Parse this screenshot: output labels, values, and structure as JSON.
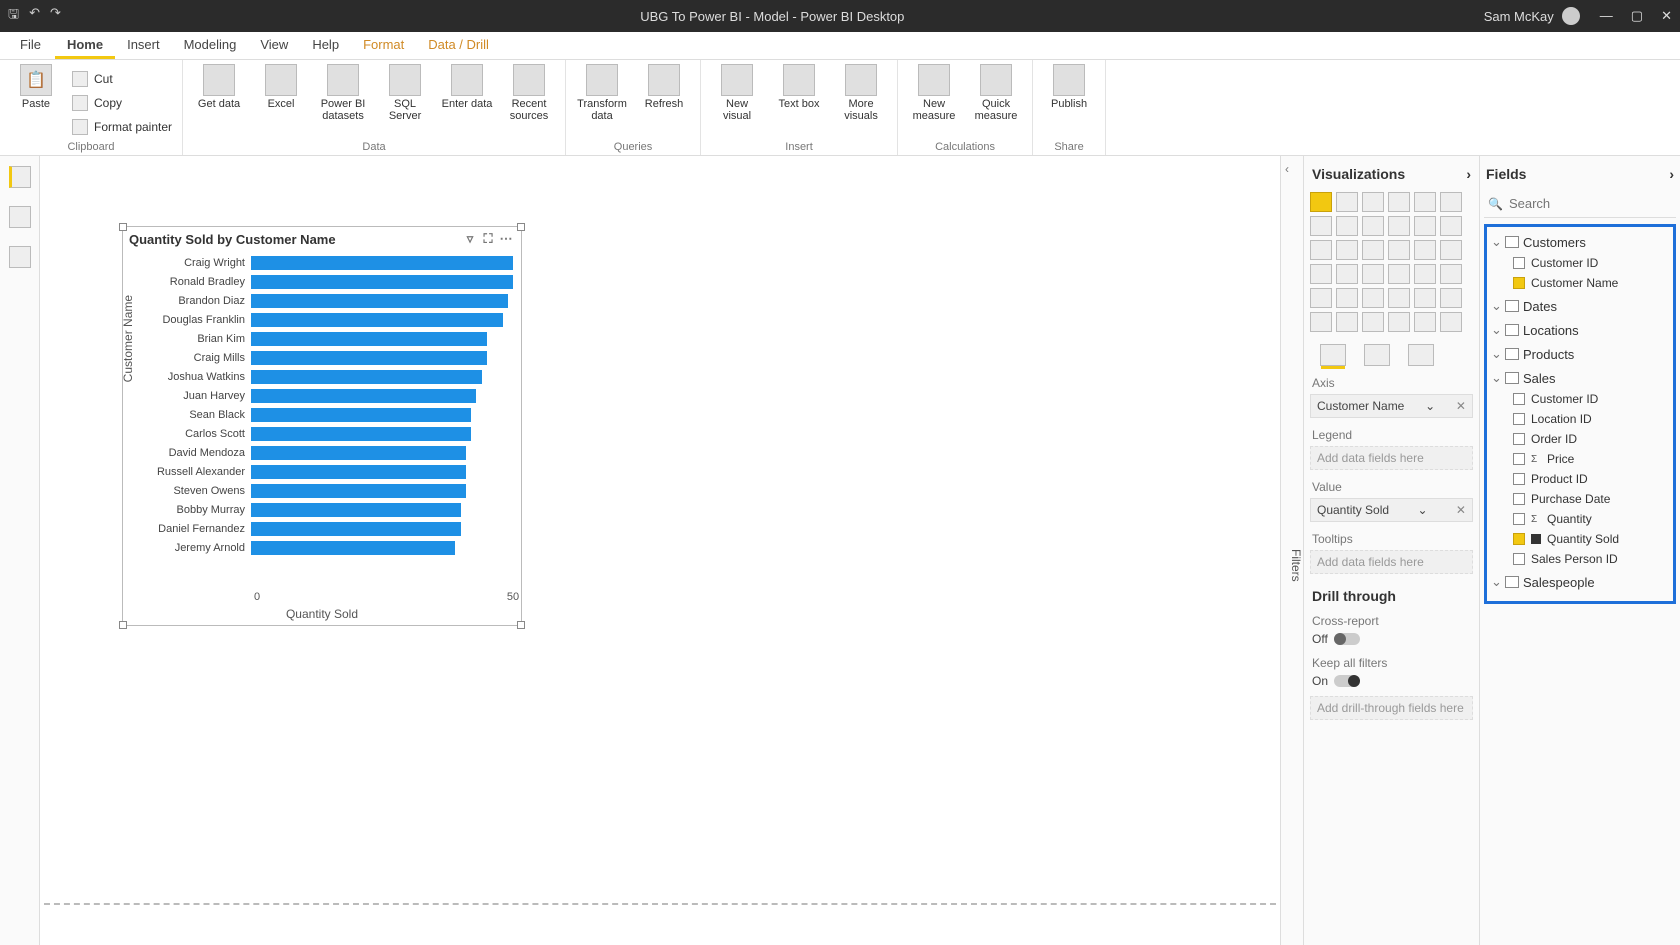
{
  "titlebar": {
    "title": "UBG To Power BI - Model - Power BI Desktop",
    "user": "Sam McKay"
  },
  "tabs": {
    "file": "File",
    "home": "Home",
    "insert": "Insert",
    "modeling": "Modeling",
    "view": "View",
    "help": "Help",
    "format": "Format",
    "datadrill": "Data / Drill"
  },
  "ribbon": {
    "clipboard": {
      "paste": "Paste",
      "cut": "Cut",
      "copy": "Copy",
      "fmtpainter": "Format painter",
      "group": "Clipboard"
    },
    "data": {
      "getdata": "Get data",
      "excel": "Excel",
      "pbids": "Power BI datasets",
      "sqlsrv": "SQL Server",
      "enter": "Enter data",
      "recent": "Recent sources",
      "group": "Data"
    },
    "queries": {
      "transform": "Transform data",
      "refresh": "Refresh",
      "group": "Queries"
    },
    "insert": {
      "newvisual": "New visual",
      "textbox": "Text box",
      "morevisuals": "More visuals",
      "group": "Insert"
    },
    "calc": {
      "newmeasure": "New measure",
      "quickmeasure": "Quick measure",
      "group": "Calculations"
    },
    "share": {
      "publish": "Publish",
      "group": "Share"
    }
  },
  "filtersLabel": "Filters",
  "vizpane": {
    "header": "Visualizations",
    "axis": "Axis",
    "axisField": "Customer Name",
    "legend": "Legend",
    "placeholder": "Add data fields here",
    "value": "Value",
    "valueField": "Quantity Sold",
    "tooltips": "Tooltips",
    "drill": "Drill through",
    "crossreport": "Cross-report",
    "off": "Off",
    "keepall": "Keep all filters",
    "on": "On",
    "drillPlaceholder": "Add drill-through fields here"
  },
  "fieldspane": {
    "header": "Fields",
    "searchPlaceholder": "Search",
    "tables": {
      "customers": {
        "name": "Customers",
        "fields": [
          "Customer ID",
          "Customer Name"
        ]
      },
      "dates": "Dates",
      "locations": "Locations",
      "products": "Products",
      "sales": {
        "name": "Sales",
        "fields": [
          "Customer ID",
          "Location ID",
          "Order ID",
          "Price",
          "Product ID",
          "Purchase Date",
          "Quantity",
          "Quantity Sold",
          "Sales Person ID"
        ]
      },
      "salespeople": "Salespeople"
    }
  },
  "visual": {
    "title": "Quantity Sold by Customer Name",
    "xlabel": "Quantity Sold",
    "ylabel": "Customer Name",
    "xtick0": "0",
    "xtick50": "50"
  },
  "chart_data": {
    "type": "bar",
    "orientation": "horizontal",
    "title": "Quantity Sold by Customer Name",
    "xlabel": "Quantity Sold",
    "ylabel": "Customer Name",
    "xlim": [
      0,
      50
    ],
    "categories": [
      "Craig Wright",
      "Ronald Bradley",
      "Brandon Diaz",
      "Douglas Franklin",
      "Brian Kim",
      "Craig Mills",
      "Joshua Watkins",
      "Juan Harvey",
      "Sean Black",
      "Carlos Scott",
      "David Mendoza",
      "Russell Alexander",
      "Steven Owens",
      "Bobby Murray",
      "Daniel Fernandez",
      "Jeremy Arnold"
    ],
    "values": [
      50,
      50,
      49,
      48,
      45,
      45,
      44,
      43,
      42,
      42,
      41,
      41,
      41,
      40,
      40,
      39
    ]
  }
}
